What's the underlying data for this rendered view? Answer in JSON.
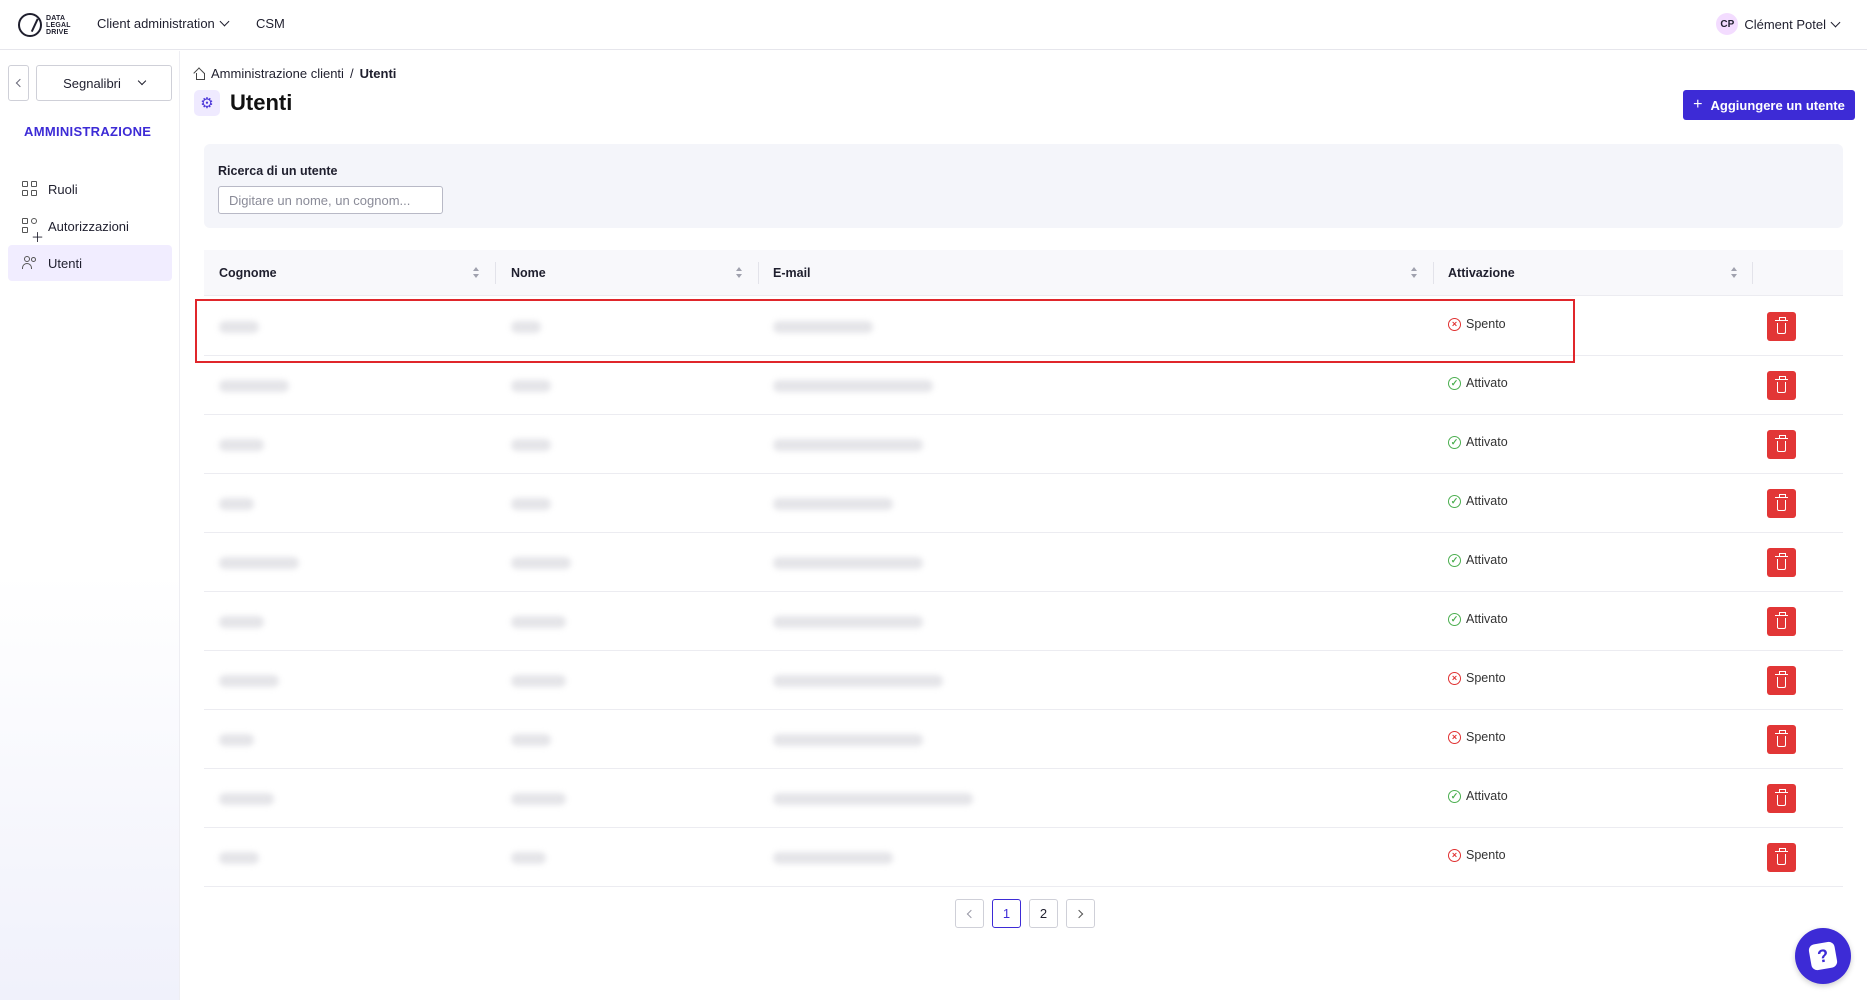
{
  "header": {
    "logo_lines": [
      "DATA",
      "LEGAL",
      "DRIVE"
    ],
    "nav": [
      {
        "label": "Client administration",
        "has_dropdown": true
      },
      {
        "label": "CSM",
        "has_dropdown": false
      }
    ],
    "user": {
      "initials": "CP",
      "name": "Clément Potel"
    }
  },
  "sidebar": {
    "bookmarks_label": "Segnalibri",
    "section_title": "AMMINISTRAZIONE",
    "items": [
      {
        "label": "Ruoli",
        "icon": "grid-icon",
        "active": false
      },
      {
        "label": "Autorizzazioni",
        "icon": "permissions-icon",
        "active": false
      },
      {
        "label": "Utenti",
        "icon": "users-icon",
        "active": true
      }
    ]
  },
  "breadcrumb": {
    "parent": "Amministrazione clienti",
    "separator": "/",
    "current": "Utenti"
  },
  "page": {
    "title": "Utenti",
    "add_button_label": "Aggiungere un utente"
  },
  "search": {
    "label": "Ricerca di un utente",
    "placeholder": "Digitare un nome, un cognom...",
    "value": ""
  },
  "table": {
    "columns": [
      "Cognome",
      "Nome",
      "E-mail",
      "Attivazione"
    ],
    "rows": [
      {
        "status": "Spento",
        "active": false
      },
      {
        "status": "Attivato",
        "active": true
      },
      {
        "status": "Attivato",
        "active": true
      },
      {
        "status": "Attivato",
        "active": true
      },
      {
        "status": "Attivato",
        "active": true
      },
      {
        "status": "Attivato",
        "active": true
      },
      {
        "status": "Spento",
        "active": false
      },
      {
        "status": "Spento",
        "active": false
      },
      {
        "status": "Attivato",
        "active": true
      },
      {
        "status": "Spento",
        "active": false
      }
    ]
  },
  "pagination": {
    "pages": [
      "1",
      "2"
    ],
    "current": "1"
  },
  "colors": {
    "primary": "#3d2bd6",
    "danger": "#e23636",
    "success": "#4caf50"
  }
}
